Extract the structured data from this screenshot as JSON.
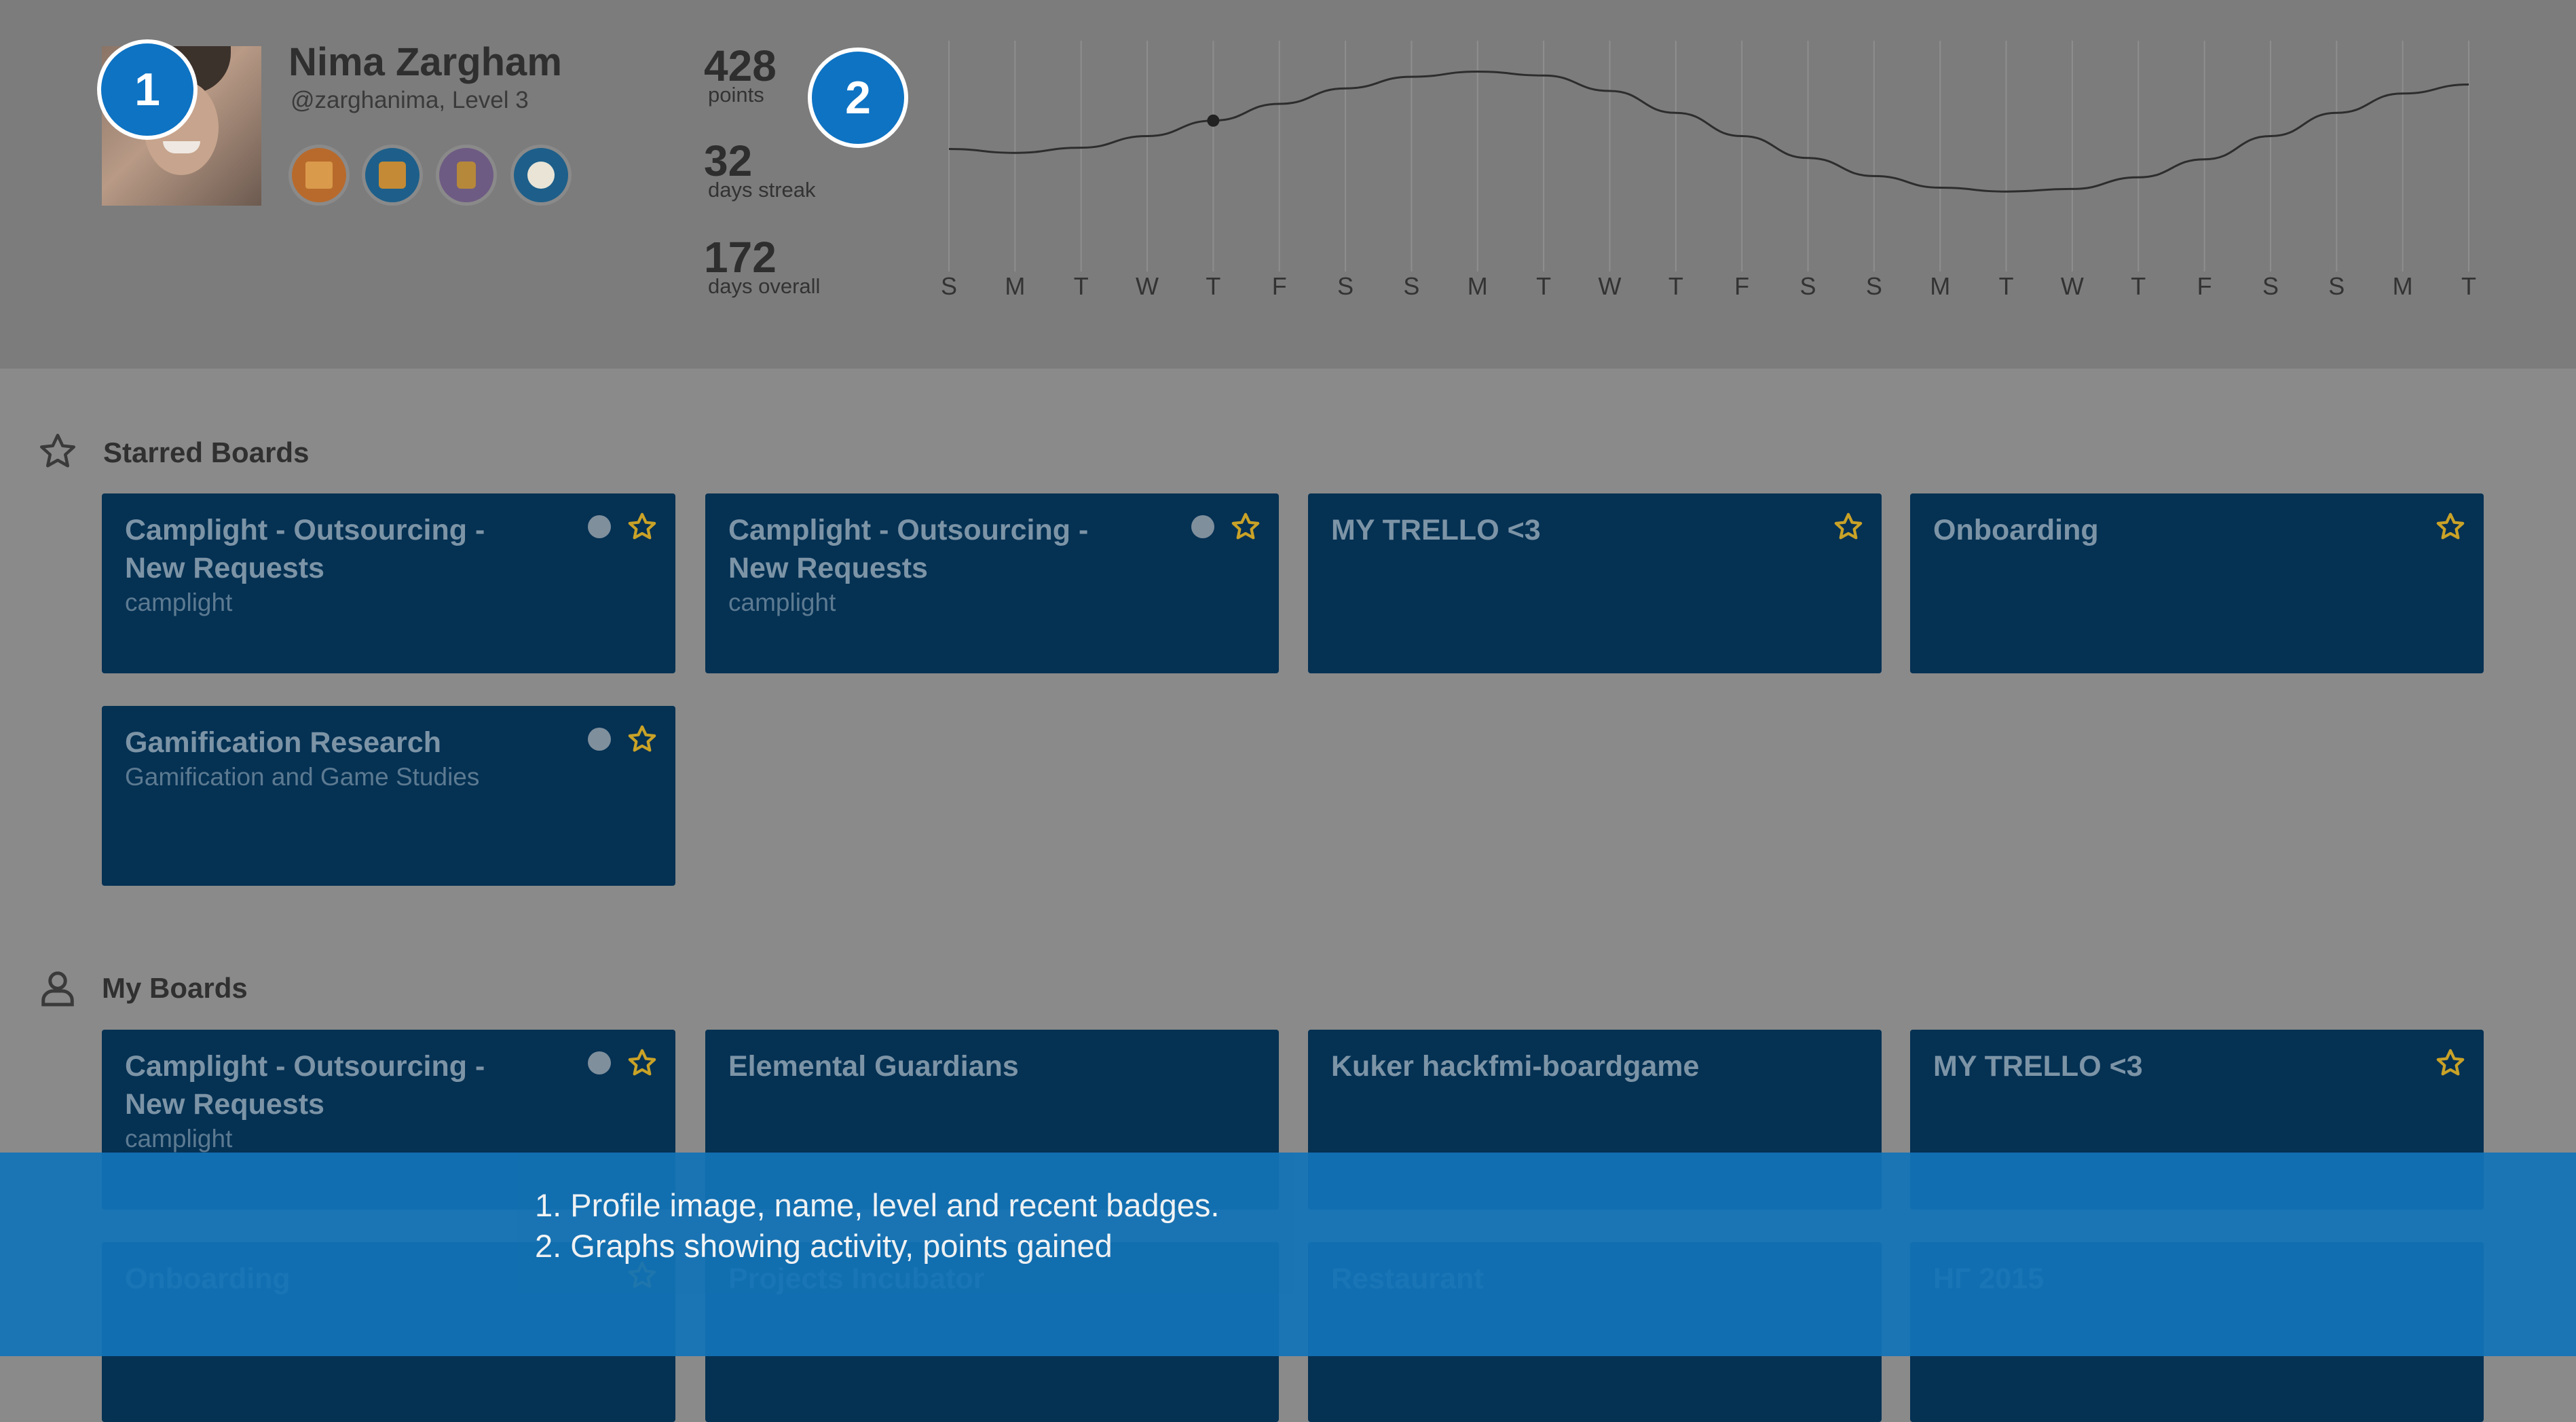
{
  "profile": {
    "name": "Nima Zargham",
    "handle": "@zarghanima, Level 3",
    "badges": [
      {
        "icon": "envelope-badge-icon",
        "color": "#b86a2c"
      },
      {
        "icon": "books-badge-icon",
        "color": "#b8772a"
      },
      {
        "icon": "door-badge-icon",
        "color": "#6e5b83"
      },
      {
        "icon": "clock-badge-icon",
        "color": "#1d5f8a"
      }
    ]
  },
  "callouts": {
    "one": "1",
    "two": "2"
  },
  "stats": {
    "points_value": "428",
    "points_label": "points",
    "streak_value": "32",
    "streak_label": "days streak",
    "overall_value": "172",
    "overall_label": "days overall"
  },
  "chart_data": {
    "type": "line",
    "x": [
      "S",
      "M",
      "T",
      "W",
      "T",
      "F",
      "S",
      "S",
      "M",
      "T",
      "W",
      "T",
      "F",
      "S",
      "S",
      "M",
      "T",
      "W",
      "T",
      "F",
      "S",
      "S",
      "M",
      "T"
    ],
    "series": [
      {
        "values": [
          0.35,
          0.32,
          0.36,
          0.45,
          0.57,
          0.7,
          0.82,
          0.91,
          0.95,
          0.92,
          0.8,
          0.63,
          0.45,
          0.28,
          0.14,
          0.05,
          0.02,
          0.04,
          0.13,
          0.27,
          0.45,
          0.63,
          0.78,
          0.85
        ]
      }
    ],
    "highlight_index": 4,
    "grid": true,
    "y_axis_visible": false
  },
  "starred": {
    "title": "Starred Boards",
    "boards": [
      {
        "title": "Camplight - Outsourcing - New Requests",
        "team": "camplight",
        "dot": true,
        "starred": true
      },
      {
        "title": "Camplight - Outsourcing - New Requests",
        "team": "camplight",
        "dot": true,
        "starred": true
      },
      {
        "title": "MY TRELLO <3",
        "team": "",
        "dot": false,
        "starred": true
      },
      {
        "title": "Onboarding",
        "team": "",
        "dot": false,
        "starred": true
      },
      {
        "title": "Gamification Research",
        "team": "Gamification and Game Studies",
        "dot": true,
        "starred": true
      }
    ]
  },
  "myboards": {
    "title": "My Boards",
    "boards": [
      {
        "title": "Camplight - Outsourcing - New Requests",
        "team": "camplight",
        "dot": true,
        "starred": true
      },
      {
        "title": "Elemental Guardians",
        "team": "",
        "dot": false,
        "starred": false
      },
      {
        "title": "Kuker hackfmi-boardgame",
        "team": "",
        "dot": false,
        "starred": false
      },
      {
        "title": "MY TRELLO <3",
        "team": "",
        "dot": false,
        "starred": true
      },
      {
        "title": "Onboarding",
        "team": "",
        "dot": false,
        "starred": true
      },
      {
        "title": "Projects Incubator",
        "team": "",
        "dot": false,
        "starred": false
      },
      {
        "title": "Restaurant",
        "team": "",
        "dot": false,
        "starred": false
      },
      {
        "title": "НГ 2015",
        "team": "",
        "dot": false,
        "starred": false
      }
    ]
  },
  "notes": [
    "1. Profile image, name, level and recent badges.",
    "2. Graphs showing activity, points gained"
  ],
  "colors": {
    "card": "#053153",
    "accent": "#1273b7",
    "star": "#c9a227"
  }
}
